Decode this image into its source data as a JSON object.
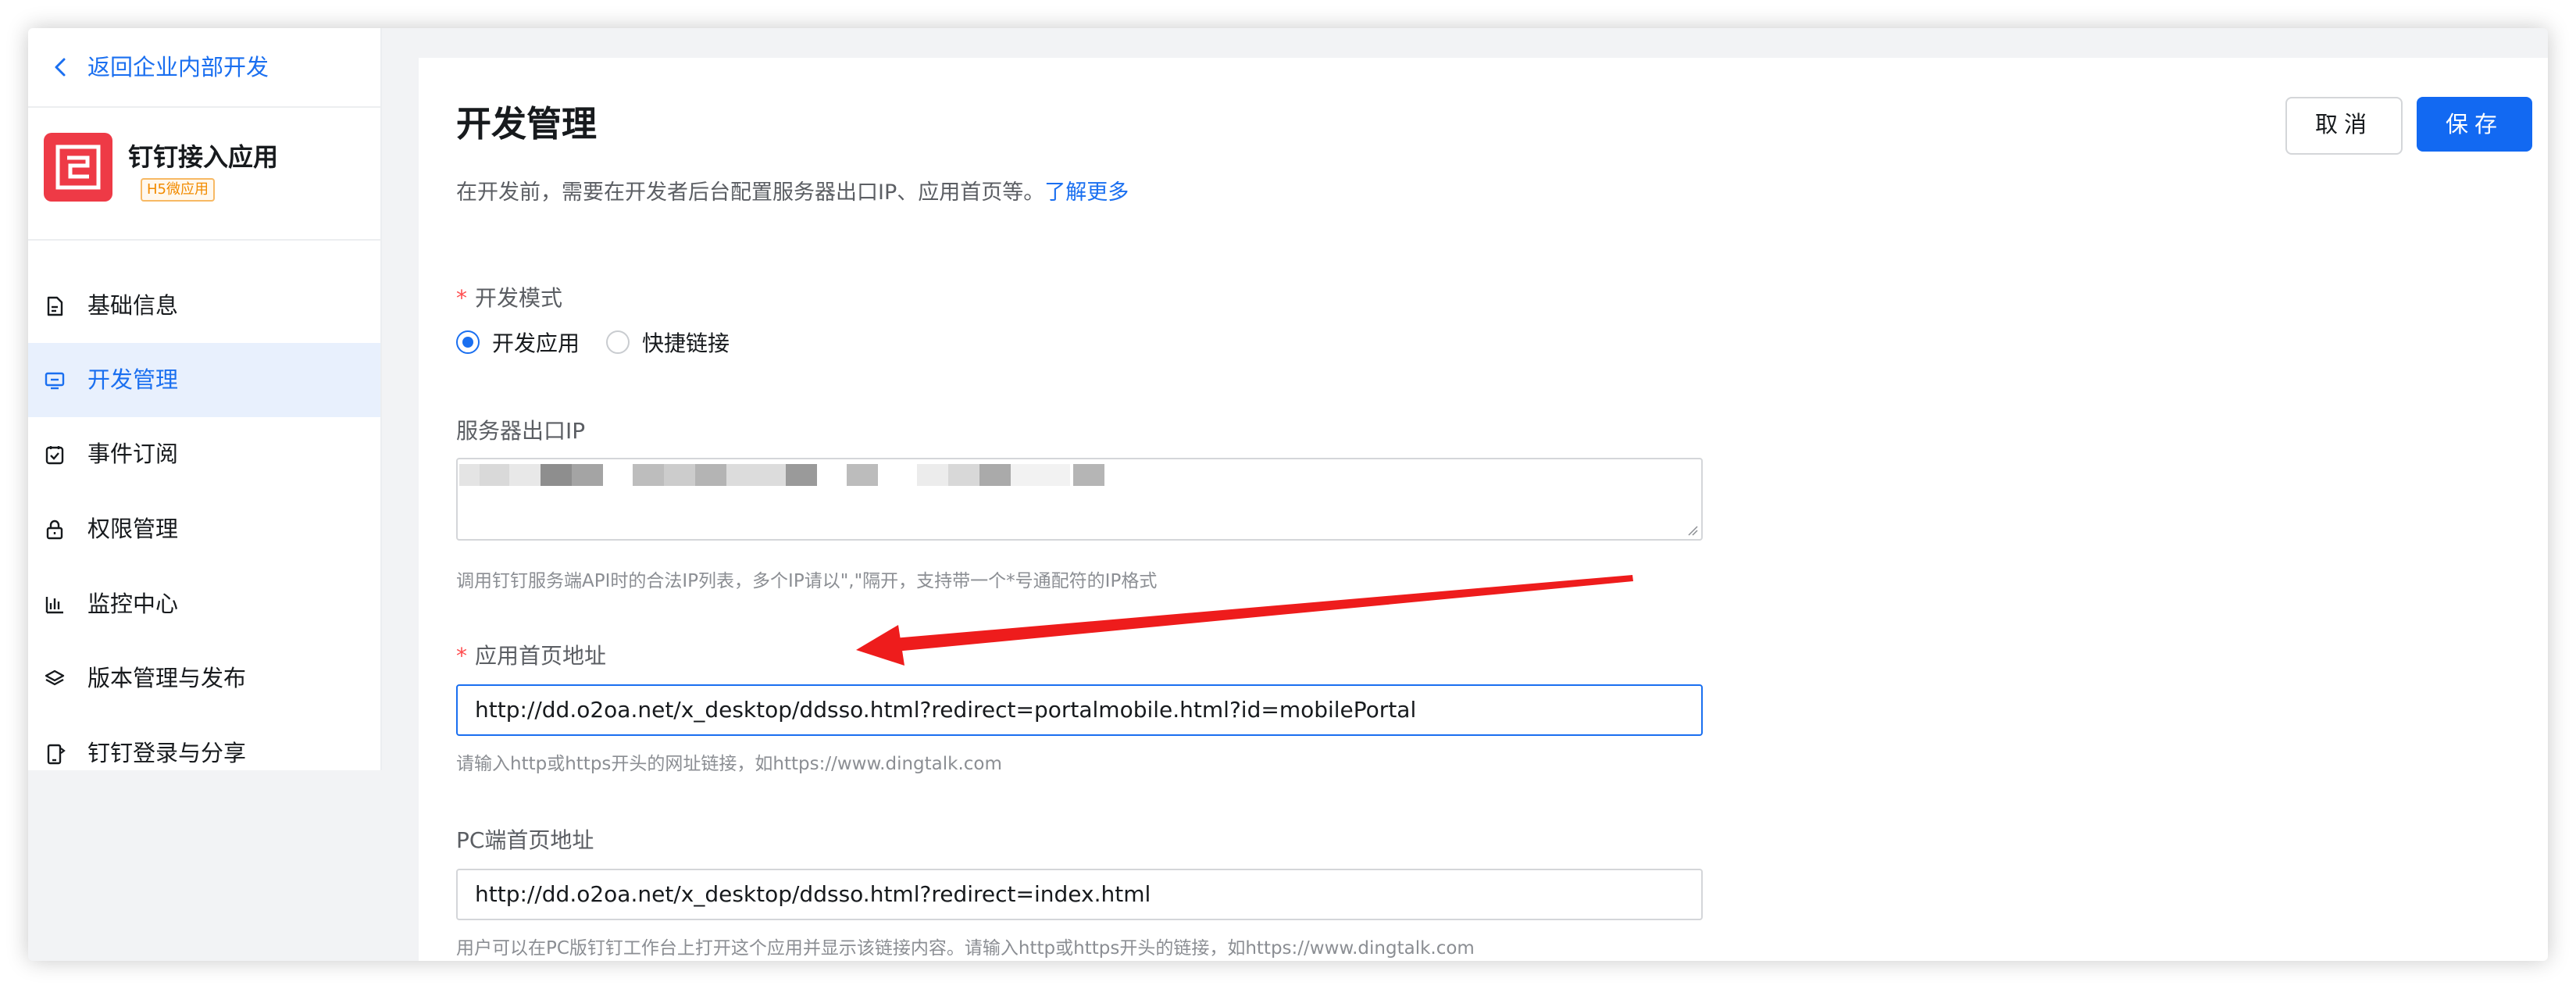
{
  "sidebar": {
    "back_label": "返回企业内部开发",
    "app_name": "钉钉接入应用",
    "app_tag": "H5微应用",
    "items": [
      {
        "label": "基础信息",
        "icon": "document-icon",
        "active": false
      },
      {
        "label": "开发管理",
        "icon": "monitor-icon",
        "active": true
      },
      {
        "label": "事件订阅",
        "icon": "calendar-check-icon",
        "active": false
      },
      {
        "label": "权限管理",
        "icon": "lock-icon",
        "active": false
      },
      {
        "label": "监控中心",
        "icon": "bar-chart-icon",
        "active": false
      },
      {
        "label": "版本管理与发布",
        "icon": "layers-icon",
        "active": false
      },
      {
        "label": "钉钉登录与分享",
        "icon": "phone-share-icon",
        "active": false
      }
    ]
  },
  "main": {
    "title": "开发管理",
    "cancel_label": "取消",
    "save_label": "保存",
    "intro_text": "在开发前，需要在开发者后台配置服务器出口IP、应用首页等。",
    "intro_link": "了解更多",
    "dev_mode": {
      "label": "开发模式",
      "options": [
        "开发应用",
        "快捷链接"
      ],
      "selected": "开发应用"
    },
    "server_ip": {
      "label": "服务器出口IP",
      "hint": "调用钉钉服务端API时的合法IP列表，多个IP请以\",\"隔开，支持带一个*号通配符的IP格式"
    },
    "homepage": {
      "label": "应用首页地址",
      "value": "http://dd.o2oa.net/x_desktop/ddsso.html?redirect=portalmobile.html?id=mobilePortal",
      "hint": "请输入http或https开头的网址链接，如https://www.dingtalk.com"
    },
    "pc_homepage": {
      "label": "PC端首页地址",
      "value": "http://dd.o2oa.net/x_desktop/ddsso.html?redirect=index.html",
      "hint": "用户可以在PC版钉钉工作台上打开这个应用并显示该链接内容。请输入http或https开头的链接，如https://www.dingtalk.com"
    }
  },
  "colors": {
    "accent": "#1a6ff0",
    "save_button": "#1269f2",
    "app_logo": "#ee3a46",
    "required_star": "#ff4d4f",
    "annotation_arrow": "#ee1c1c"
  }
}
